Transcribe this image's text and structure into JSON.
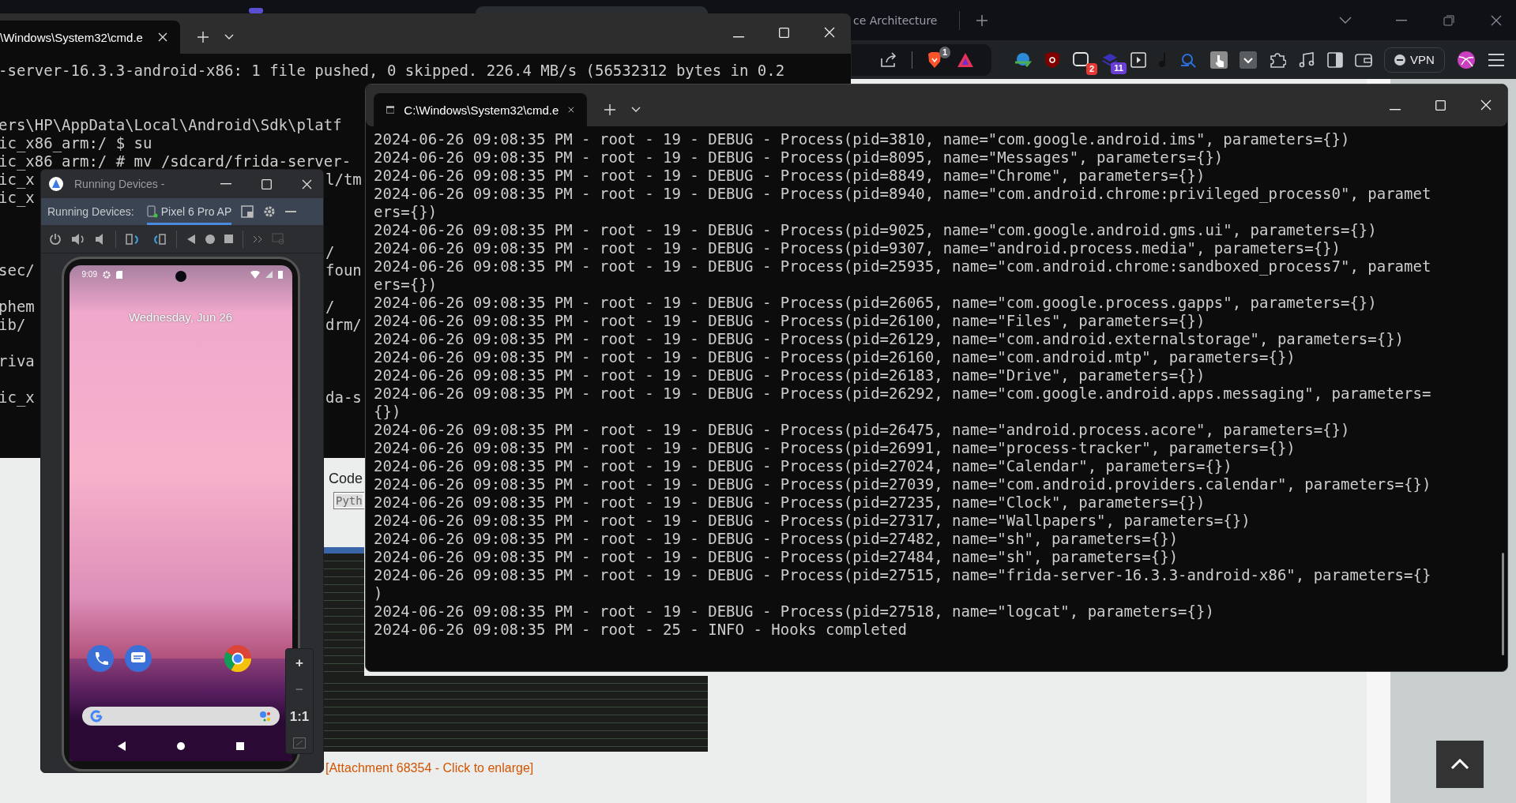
{
  "browser": {
    "tab_title": "ce Architecture",
    "badges": [
      "1",
      "2",
      "11"
    ],
    "vpn_label": "VPN"
  },
  "page": {
    "code_label": "Code",
    "code_field_value": "Pyth",
    "attachment_link": "[Attachment 68354 - Click to enlarge]"
  },
  "back_terminal": {
    "tab_title": "\\Windows\\System32\\cmd.e",
    "lines": [
      {
        "kind": "text",
        "left": "-server-16.3.3-android-x86: 1 file pushed, 0 skipped. 226.4 MB/s (56532312 bytes in 0.2"
      },
      {
        "kind": "blank"
      },
      {
        "kind": "blank"
      },
      {
        "kind": "text",
        "left": "ers\\HP\\AppData\\Local\\Android\\Sdk\\platf"
      },
      {
        "kind": "text",
        "left": "ic_x86_arm:/ $ su"
      },
      {
        "kind": "text",
        "left": "ic_x86_arm:/ # mv /sdcard/frida-server-"
      },
      {
        "kind": "text",
        "left": "ic_x",
        "right": "l/tm"
      },
      {
        "kind": "text",
        "left": "ic_x"
      },
      {
        "kind": "blank"
      },
      {
        "kind": "blank"
      },
      {
        "kind": "text",
        "right": "/"
      },
      {
        "kind": "text",
        "left": "sec/",
        "right": "foun"
      },
      {
        "kind": "blank"
      },
      {
        "kind": "text",
        "left": "phem",
        "right": "/"
      },
      {
        "kind": "text",
        "left": "ib/",
        "right": "drm/"
      },
      {
        "kind": "blank"
      },
      {
        "kind": "text",
        "left": "riva"
      },
      {
        "kind": "blank"
      },
      {
        "kind": "text",
        "left": "ic_x",
        "right": "da-s"
      }
    ]
  },
  "front_terminal": {
    "tab_title": "C:\\Windows\\System32\\cmd.e",
    "lines": [
      "2024-06-26 09:08:35 PM - root - 19 - DEBUG - Process(pid=3810, name=\"com.google.android.ims\", parameters={})",
      "2024-06-26 09:08:35 PM - root - 19 - DEBUG - Process(pid=8095, name=\"Messages\", parameters={})",
      "2024-06-26 09:08:35 PM - root - 19 - DEBUG - Process(pid=8849, name=\"Chrome\", parameters={})",
      "2024-06-26 09:08:35 PM - root - 19 - DEBUG - Process(pid=8940, name=\"com.android.chrome:privileged_process0\", paramet",
      "ers={})",
      "2024-06-26 09:08:35 PM - root - 19 - DEBUG - Process(pid=9025, name=\"com.google.android.gms.ui\", parameters={})",
      "2024-06-26 09:08:35 PM - root - 19 - DEBUG - Process(pid=9307, name=\"android.process.media\", parameters={})",
      "2024-06-26 09:08:35 PM - root - 19 - DEBUG - Process(pid=25935, name=\"com.android.chrome:sandboxed_process7\", paramet",
      "ers={})",
      "2024-06-26 09:08:35 PM - root - 19 - DEBUG - Process(pid=26065, name=\"com.google.process.gapps\", parameters={})",
      "2024-06-26 09:08:35 PM - root - 19 - DEBUG - Process(pid=26100, name=\"Files\", parameters={})",
      "2024-06-26 09:08:35 PM - root - 19 - DEBUG - Process(pid=26129, name=\"com.android.externalstorage\", parameters={})",
      "2024-06-26 09:08:35 PM - root - 19 - DEBUG - Process(pid=26160, name=\"com.android.mtp\", parameters={})",
      "2024-06-26 09:08:35 PM - root - 19 - DEBUG - Process(pid=26183, name=\"Drive\", parameters={})",
      "2024-06-26 09:08:35 PM - root - 19 - DEBUG - Process(pid=26292, name=\"com.google.android.apps.messaging\", parameters=",
      "{})",
      "2024-06-26 09:08:35 PM - root - 19 - DEBUG - Process(pid=26475, name=\"android.process.acore\", parameters={})",
      "2024-06-26 09:08:35 PM - root - 19 - DEBUG - Process(pid=26991, name=\"process-tracker\", parameters={})",
      "2024-06-26 09:08:35 PM - root - 19 - DEBUG - Process(pid=27024, name=\"Calendar\", parameters={})",
      "2024-06-26 09:08:35 PM - root - 19 - DEBUG - Process(pid=27039, name=\"com.android.providers.calendar\", parameters={})",
      "2024-06-26 09:08:35 PM - root - 19 - DEBUG - Process(pid=27235, name=\"Clock\", parameters={})",
      "2024-06-26 09:08:35 PM - root - 19 - DEBUG - Process(pid=27317, name=\"Wallpapers\", parameters={})",
      "2024-06-26 09:08:35 PM - root - 19 - DEBUG - Process(pid=27482, name=\"sh\", parameters={})",
      "2024-06-26 09:08:35 PM - root - 19 - DEBUG - Process(pid=27484, name=\"sh\", parameters={})",
      "2024-06-26 09:08:35 PM - root - 19 - DEBUG - Process(pid=27515, name=\"frida-server-16.3.3-android-x86\", parameters={}",
      ")",
      "2024-06-26 09:08:35 PM - root - 19 - DEBUG - Process(pid=27518, name=\"logcat\", parameters={})",
      "2024-06-26 09:08:35 PM - root - 25 - INFO - Hooks completed"
    ]
  },
  "emulator": {
    "title": "Running Devices -",
    "panel_label": "Running Devices:",
    "tabs": [
      {
        "label": "Pixel 6 Pro AP",
        "selected": true
      }
    ],
    "phone": {
      "time": "9:09",
      "date": "Wednesday, Jun 26"
    },
    "zoom_controls": [
      {
        "label": "+",
        "disabled": false
      },
      {
        "label": "−",
        "disabled": true
      },
      {
        "label": "1:1",
        "disabled": false
      }
    ]
  }
}
